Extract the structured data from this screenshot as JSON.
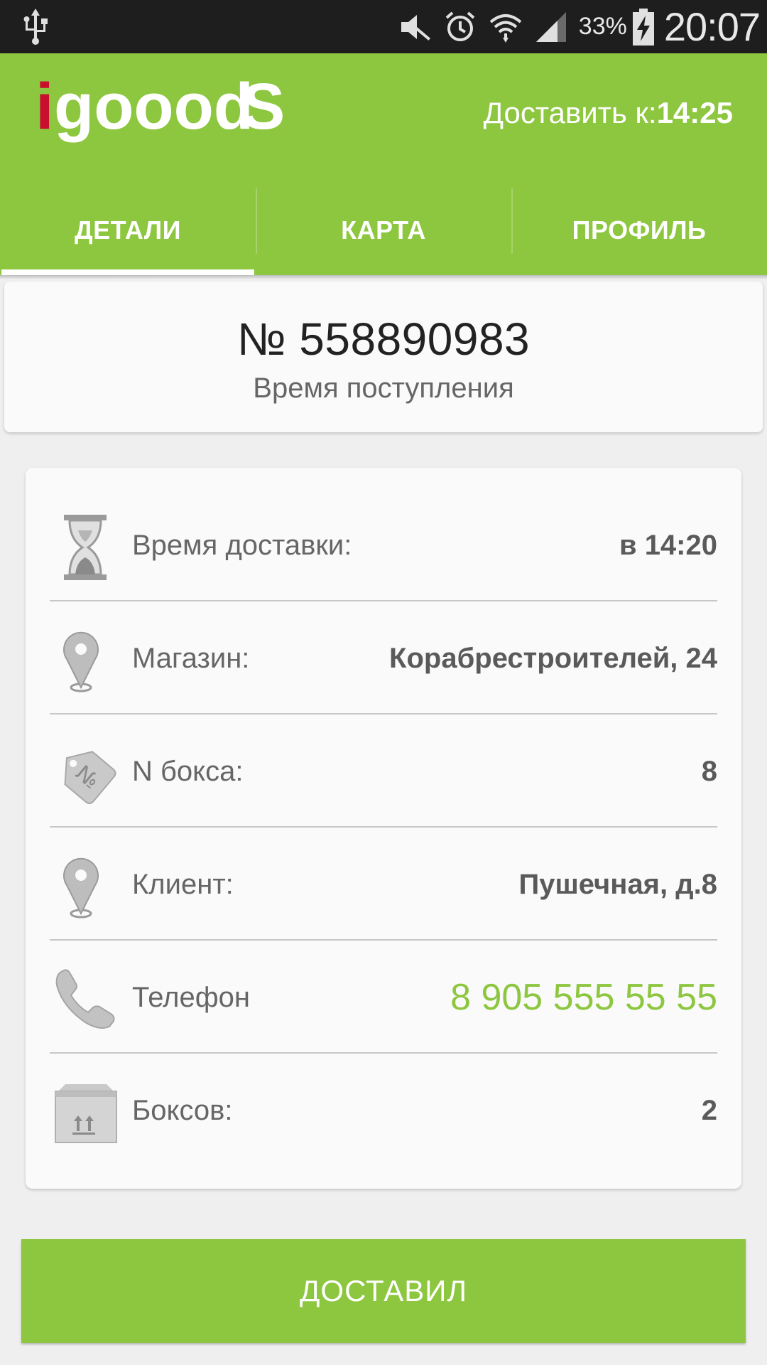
{
  "status_bar": {
    "battery_percent": "33%",
    "time": "20:07",
    "icons": [
      "usb-icon",
      "mute-icon",
      "alarm-icon",
      "wifi-icon",
      "signal-icon",
      "battery-charging-icon"
    ]
  },
  "header": {
    "logo_text": "igooodS",
    "deliver_label": "Доставить к:",
    "deliver_time": "14:25",
    "brand_color": "#8dc63f",
    "logo_accent_color": "#c8102e"
  },
  "tabs": [
    {
      "label": "ДЕТАЛИ",
      "active": true
    },
    {
      "label": "КАРТА",
      "active": false
    },
    {
      "label": "ПРОФИЛЬ",
      "active": false
    }
  ],
  "order": {
    "number": "№ 558890983",
    "subtitle": "Время поступления"
  },
  "details": [
    {
      "icon": "hourglass-icon",
      "label": "Время доставки:",
      "value": "в 14:20"
    },
    {
      "icon": "map-pin-icon",
      "label": "Магазин:",
      "value": "Корабрестроителей, 24"
    },
    {
      "icon": "tag-icon",
      "label": "N бокса:",
      "value": "8"
    },
    {
      "icon": "map-pin-icon",
      "label": "Клиент:",
      "value": "Пушечная, д.8"
    },
    {
      "icon": "phone-icon",
      "label": "Телефон",
      "value": "8 905 555 55 55"
    },
    {
      "icon": "box-icon",
      "label": "Боксов:",
      "value": "2"
    }
  ],
  "action": {
    "delivered_label": "ДОСТАВИЛ"
  }
}
